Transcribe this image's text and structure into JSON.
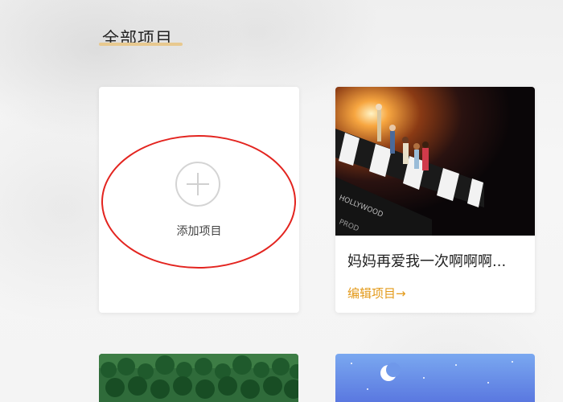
{
  "section": {
    "title": "全部项目"
  },
  "add_card": {
    "label": "添加项目",
    "icon": "plus-circle-icon"
  },
  "projects": [
    {
      "name": "妈妈再爱我一次啊啊啊...",
      "edit_label": "编辑项目→",
      "thumbnail": "film-clapperboard-figurines"
    }
  ],
  "bottom_cards": [
    {
      "thumbnail": "forest-hills"
    },
    {
      "thumbnail": "night-sky-moon"
    }
  ],
  "colors": {
    "accent": "#e39a1a",
    "title_underline": "#e8c98f",
    "annotation": "#e3241f"
  }
}
